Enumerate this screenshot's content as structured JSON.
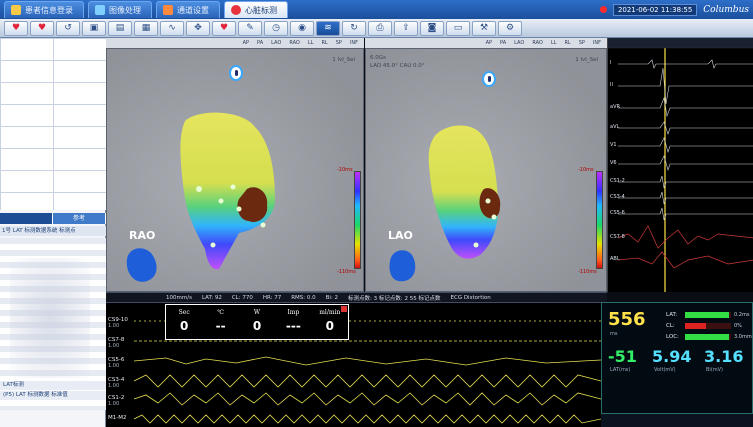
{
  "tabs": [
    {
      "label": "患者信息登录",
      "active": false,
      "icon": "patient-icon"
    },
    {
      "label": "图像处理",
      "active": false,
      "icon": "image-icon"
    },
    {
      "label": "通道设置",
      "active": false,
      "icon": "channel-icon"
    },
    {
      "label": "心脏标测",
      "active": true,
      "icon": "heart-icon"
    }
  ],
  "clock": "2021-06-02 11:38:55",
  "brand": "Columbus",
  "view_bar_labels": [
    "AP",
    "PA",
    "LAO",
    "RAO",
    "LL",
    "RL",
    "SP",
    "INF"
  ],
  "left_panel": {
    "subtabs": [
      "",
      "参考"
    ],
    "header_text": "1号 LAT 标测数据系统 标测点",
    "footer_rows": [
      "LAT标测",
      "(P5)   LAT 标测数据 标准值"
    ]
  },
  "views": [
    {
      "orientation": "RAO",
      "info": "1 lvl_Sel",
      "scale_top": "-10ms",
      "scale_bottom": "-110ms"
    },
    {
      "orientation": "LAO",
      "info_top": "6.0Gs",
      "info_line": "LAO 45.0°  CAU 0.0°",
      "info_right": "1 lvl_Sel",
      "scale_top": "-10ms",
      "scale_bottom": "-110ms"
    }
  ],
  "status_line": [
    "100mm/s",
    "LAT: 92",
    "CL: 770",
    "HR: 77",
    "RMS: 0.0",
    "Bi: 2",
    "标测点数: 3  标记点数: 2  55 标记点数",
    "ECG Distortion"
  ],
  "ecg_labels": [
    "I",
    "II",
    "aVR",
    "aVL",
    "V1",
    "V6",
    "CS1-2",
    "CS3-4",
    "CS5-6",
    "CS7-8",
    "ABL"
  ],
  "strip_channels": [
    {
      "label": "CS9-10",
      "sub": "1.00"
    },
    {
      "label": "CS7-8",
      "sub": "1.00"
    },
    {
      "label": "CS5-6",
      "sub": "1.00"
    },
    {
      "label": "CS3-4",
      "sub": "1.00"
    },
    {
      "label": "CS1-2",
      "sub": "1.00"
    },
    {
      "label": "M1-M2",
      "sub": ""
    }
  ],
  "ablation": [
    {
      "name": "Sec",
      "value": "0"
    },
    {
      "name": "℃",
      "value": "--"
    },
    {
      "name": "W",
      "value": "0"
    },
    {
      "name": "Imp",
      "value": "---"
    },
    {
      "name": "ml/min",
      "value": "0"
    }
  ],
  "stats": {
    "big_value": "556",
    "big_sub": "ms",
    "bars": [
      {
        "label": "LAT:",
        "fraction": 0.95,
        "value": "0.2ms",
        "color": "#33dd44"
      },
      {
        "label": "CL:",
        "fraction": 0.45,
        "value": "0%",
        "color": "#dd2222"
      },
      {
        "label": "LOC:",
        "fraction": 0.95,
        "value": "3.0mm",
        "color": "#33dd44"
      }
    ],
    "triple": [
      {
        "value": "-51",
        "label": "LAT(ms)",
        "color": "#33ee66"
      },
      {
        "value": "5.94",
        "label": "Volt(mV)",
        "color": "#55e0ff"
      },
      {
        "value": "3.16",
        "label": "Bi(mV)",
        "color": "#55e0ff"
      }
    ]
  }
}
